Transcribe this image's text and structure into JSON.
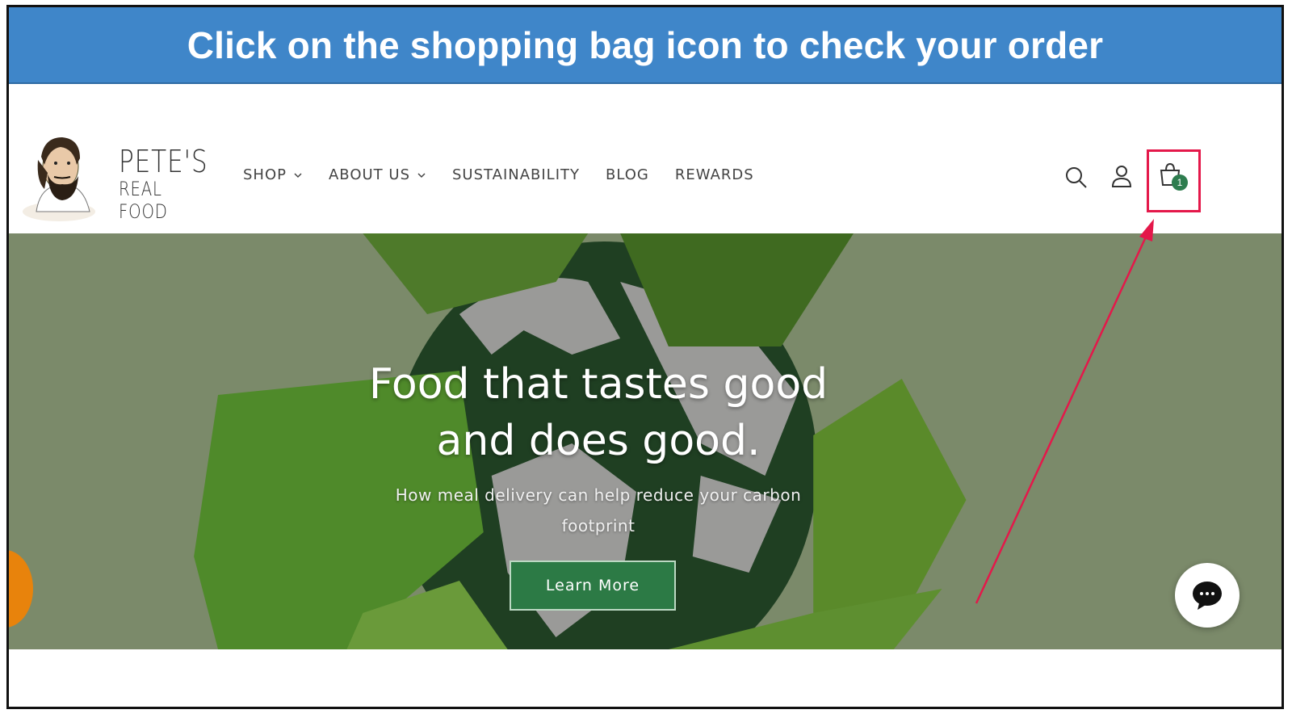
{
  "banner": {
    "text": "Click on the shopping bag icon to check your order"
  },
  "logo": {
    "line1": "PETE'S",
    "line2": "REAL FOOD"
  },
  "nav": {
    "items": [
      {
        "label": "SHOP",
        "dropdown": true
      },
      {
        "label": "ABOUT US",
        "dropdown": true
      },
      {
        "label": "SUSTAINABILITY",
        "dropdown": false
      },
      {
        "label": "BLOG",
        "dropdown": false
      },
      {
        "label": "REWARDS",
        "dropdown": false
      }
    ]
  },
  "header_icons": {
    "search": "search-icon",
    "account": "account-icon",
    "cart": "shopping-bag-icon",
    "cart_count": "1"
  },
  "hero": {
    "title_line1": "Food that tastes good",
    "title_line2": "and does good.",
    "subtitle": "How meal delivery can help reduce your carbon footprint",
    "button_label": "Learn More"
  },
  "colors": {
    "banner": "#3f86c9",
    "hero_bg": "#7b8a6a",
    "button": "#2c7a45",
    "highlight": "#e4184a",
    "cart_badge": "#2e7d4f"
  }
}
